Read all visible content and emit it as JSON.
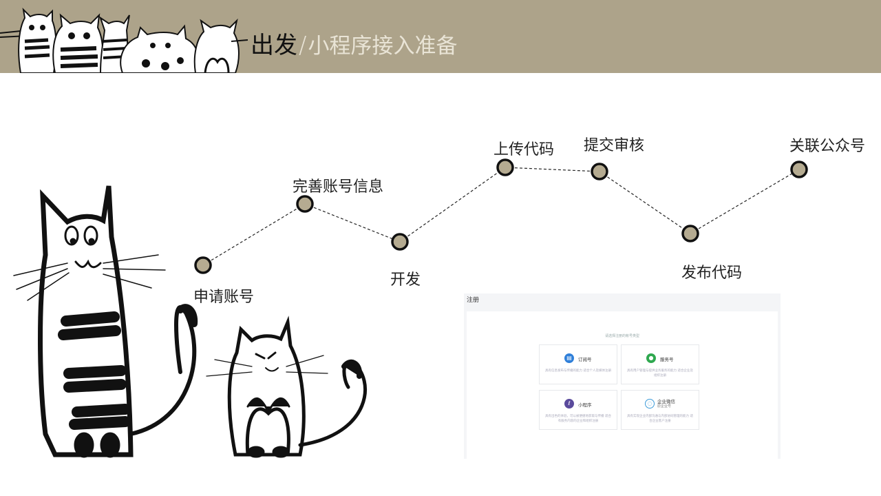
{
  "header": {
    "title_main": "出发",
    "separator": "/",
    "title_sub": "小程序接入准备",
    "bg_color": "#ada38a"
  },
  "timeline": {
    "node_color": "#b5ab91",
    "steps": [
      {
        "label": "申请账号"
      },
      {
        "label": "完善账号信息"
      },
      {
        "label": "开发"
      },
      {
        "label": "上传代码"
      },
      {
        "label": "提交审核"
      },
      {
        "label": "发布代码"
      },
      {
        "label": "关联公众号"
      }
    ]
  },
  "screenshot": {
    "title": "注册",
    "hint": "请选择注册的帐号类型",
    "cards": [
      {
        "name": "订阅号",
        "sub": "",
        "desc": "具有信息发布与传播的能力 适合个人及媒体注册",
        "icon": "subscription-icon",
        "color": "#2f7fd9"
      },
      {
        "name": "服务号",
        "sub": "",
        "desc": "具有用户管理与提供业务服务的能力 适合企业及组织注册",
        "icon": "service-icon",
        "color": "#2fa84f"
      },
      {
        "name": "小程序",
        "sub": "",
        "desc": "具有出色的体验，可以被便捷地获取与传播 适合有服务内容的企业和组织注册",
        "icon": "mini-program-icon",
        "color": "#5a4a9c"
      },
      {
        "name": "企业微信",
        "sub": "原企业号",
        "desc": "具有实现企业内部沟通与内部协同管理的能力 适合企业客户注册",
        "icon": "work-wechat-icon",
        "color": "#3a9ad9"
      }
    ]
  }
}
